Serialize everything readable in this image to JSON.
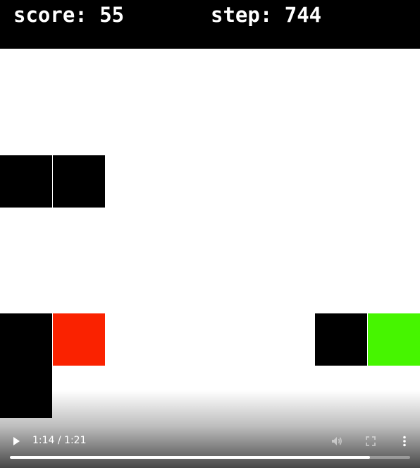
{
  "hud": {
    "score_text": "score: 55",
    "step_text": "step: 744"
  },
  "board": {
    "background": "#ffffff",
    "tile_size_cells": 1,
    "tiles": [
      {
        "kind": "wall",
        "col": 0,
        "row": 2,
        "color": "#000000"
      },
      {
        "kind": "wall",
        "col": 1,
        "row": 2,
        "color": "#000000"
      },
      {
        "kind": "wall",
        "col": 0,
        "row": 5,
        "color": "#000000"
      },
      {
        "kind": "player",
        "col": 1,
        "row": 5,
        "color": "#fa2200"
      },
      {
        "kind": "wall",
        "col": 0,
        "row": 6,
        "color": "#000000"
      },
      {
        "kind": "wall",
        "col": 6,
        "row": 5,
        "color": "#000000"
      },
      {
        "kind": "goal",
        "col": 7,
        "row": 5,
        "color": "#46f500"
      }
    ]
  },
  "video": {
    "time_text": "1:14 / 1:21",
    "progress_fraction": 0.9,
    "play_icon": "play-icon",
    "volume_icon": "volume-icon",
    "fullscreen_icon": "fullscreen-icon",
    "more_icon": "more-vertical-icon"
  }
}
